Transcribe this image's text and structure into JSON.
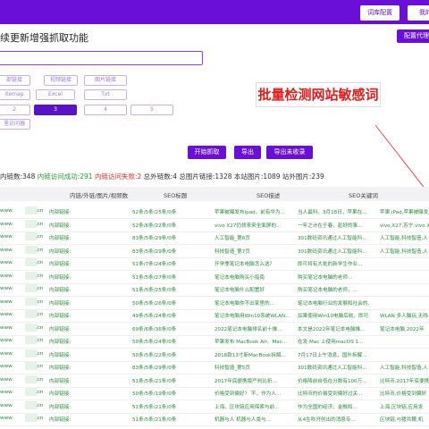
{
  "header": {
    "lexicon_label": "词库配置",
    "user_label": "我的"
  },
  "page_title": "续更新增强抓取功能",
  "proxy_button": "配置代理",
  "url_input": {
    "value": ""
  },
  "chips_row1": [
    "部链接",
    "视频链接",
    "图片链接"
  ],
  "chips_row2": [
    "itemap",
    "Excel",
    "Txt"
  ],
  "depth": {
    "options": [
      "2",
      "3",
      "4",
      "5"
    ],
    "selected": "3"
  },
  "chip_row4": "里访问器",
  "watermark": "批量检测网站敏感词",
  "actions": {
    "start": "开始抓取",
    "export": "导出",
    "export_unrecorded": "导出未收录"
  },
  "stats": {
    "internal": "内链数:348",
    "success": "内链访问成功:291",
    "failed": "内链访问失败:2",
    "external": "总外链数:4",
    "images": "总图片链接:1328",
    "site_images": "本站图片:1089",
    "external_images": "站外图片:239"
  },
  "table": {
    "headers": [
      "内链/外链/图片/视频数",
      "SEO标题",
      "SEO描述",
      "SEO关键词"
    ],
    "rows": [
      {
        "url": "www.",
        "tail": ".cn",
        "link": "内部链接:",
        "count": "52条/5条/25条/0条",
        "title": "苹果被曝发布ipad，前有华为...",
        "desc": "当人最科，3月18日，苹果在...",
        "kw": "苹果,iPad,苹果被曝发"
      },
      {
        "url": "www.",
        "tail": ".cn",
        "link": "内部链接:",
        "count": "52条/6条/22条/0条",
        "title": "vivo X27仍领来来全面屏的...",
        "desc": "一年之计在于春，趁好的事...",
        "kw": "vivo,X27,苏宁,vivo X"
      },
      {
        "url": "www.",
        "tail": ".cn",
        "link": "内部链接:",
        "count": "83条/5条/29条/0条",
        "title": "人工智能_第6页",
        "desc": "301数码资讯通过人工智能科...",
        "kw": "人工智能,科技智造,人"
      },
      {
        "url": "www.",
        "tail": ".cn",
        "link": "内部链接:",
        "count": "83条/5条/29条/0条",
        "title": "科技智造_第7页",
        "desc": "301数码资讯通过人工智能科...",
        "kw": "人工智能,科技智造,人"
      },
      {
        "url": "www.",
        "tail": ".cn",
        "link": "内部链接:",
        "count": "51条/7条/24条/0条",
        "title": "开学季笔记本电脑怎么选？",
        "desc": "即可将有大批的新学生作业...",
        "kw": ""
      },
      {
        "url": "www.",
        "tail": ".cn",
        "link": "内部链接:",
        "count": "51条/5条/27条/0条",
        "title": "笔记本电脑购买小指南",
        "desc": "购买笔记本电脑的老师...",
        "kw": ""
      },
      {
        "url": "www.",
        "tail": ".cn",
        "link": "内部链接:",
        "count": "51条/5条/25条/0条",
        "title": "笔记本电脑什么配置好",
        "desc": "购买笔记本电脑的老师，...",
        "kw": ""
      },
      {
        "url": "www.",
        "tail": ".cn",
        "link": "内部链接:",
        "count": "50条/5条/26条/0条",
        "title": "笔记本电脑你不出家里的...",
        "desc": "笔记本电脑行业的发展和社会的...",
        "kw": ""
      },
      {
        "url": "www.",
        "tail": ".cn",
        "link": "内部链接:",
        "count": "49条/5条/24条/0条",
        "title": "笔记本电脑用Win10系统WLAN...",
        "desc": "如果使用Win10电脑后收，即可...",
        "kw": "WLAN 多人脑玩,无线"
      },
      {
        "url": "www.",
        "tail": ".cn",
        "link": "内部链接:",
        "count": "69条/6条/36条/0条",
        "title": "2022笔记本电脑排名前十推...",
        "desc": "本文是2022年笔记本电脑推...",
        "kw": "笔记本电脑,2022年"
      },
      {
        "url": "www.",
        "tail": ".cn",
        "link": "内部链接:",
        "count": "50条/5条/24条/0条",
        "title": "苹果发布 MacBook Air、Mac...",
        "desc": "在发 Mac 上使用macOS 1...",
        "kw": ""
      },
      {
        "url": "www.",
        "tail": ".cn",
        "link": "内部链接:",
        "count": "50条/5条/22条/0条",
        "title": "2018款13寸新MacBook拆解...",
        "desc": "7月17日上午消息，国外拆解...",
        "kw": ""
      },
      {
        "url": "www.",
        "tail": ".cn",
        "link": "内部链接:",
        "count": "83条/5条/29条/0条",
        "title": "科技智造_第5页",
        "desc": "301数码资讯通过人工智能科...",
        "kw": "人工智能,科技智造,人"
      },
      {
        "url": "www.",
        "tail": ".cn",
        "link": "内部链接:",
        "count": "51条/5条/21条/0条",
        "title": "2017年底便携版严判比折...",
        "desc": "价格降前自低在分数有100万...",
        "kw": "比特币,2017年底便携"
      },
      {
        "url": "www.",
        "tail": ".cn",
        "link": "内部链接:",
        "count": "50条/5条/19条/0条",
        "title": "价格受到偏好？ 不，作为人...",
        "desc": "比特币的价格受到偏好过关...",
        "kw": "比特币,价格受到偏好"
      },
      {
        "url": "www.",
        "tail": ".cn",
        "link": "内部链接:",
        "count": "51条/5条/21条/0条",
        "title": "上海，区块链应用探索与前...",
        "desc": "作为全国的经济，金融和...",
        "kw": "上海,区块链,应用发"
      },
      {
        "url": "www.",
        "tail": ".cn",
        "link": "内部链接:",
        "count": "51条/5条/21条/0条",
        "title": "机器与人 机器与人类与...",
        "desc": "从4生吹开创出的消息专...",
        "kw": "区块链,与猪共鞭,机"
      }
    ]
  }
}
